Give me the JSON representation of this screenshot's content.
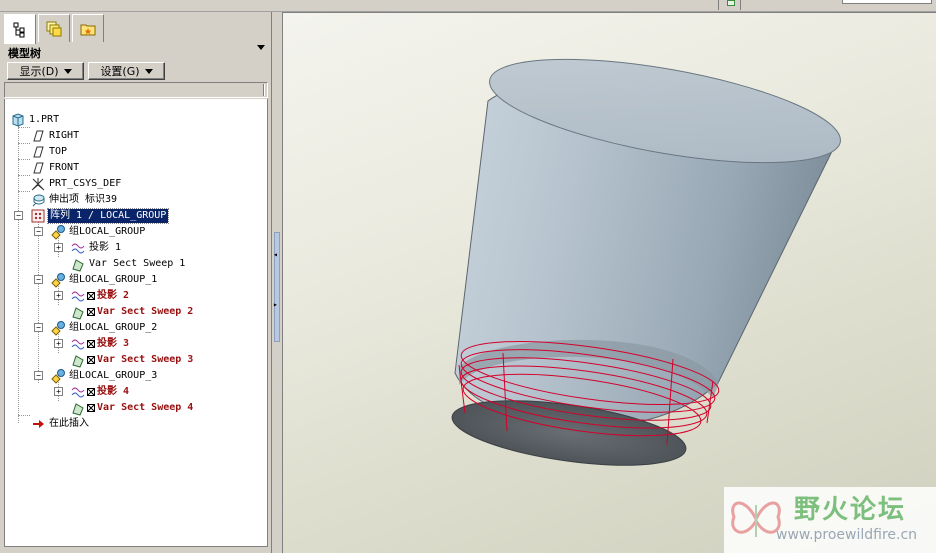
{
  "panel": {
    "title": "模型树",
    "show_button": "显示(D)",
    "settings_button": "设置(G)",
    "tabs": [
      {
        "name": "model-tree-tab",
        "icon": "tree-icon"
      },
      {
        "name": "layers-tab",
        "icon": "layers-icon"
      },
      {
        "name": "favorites-tab",
        "icon": "folder-star-icon"
      }
    ]
  },
  "tree": {
    "root": "1.PRT",
    "items": [
      {
        "label": "RIGHT",
        "icon": "datum-plane-icon"
      },
      {
        "label": "TOP",
        "icon": "datum-plane-icon"
      },
      {
        "label": "FRONT",
        "icon": "datum-plane-icon"
      },
      {
        "label": "PRT_CSYS_DEF",
        "icon": "csys-icon"
      },
      {
        "label": "伸出项 标识39",
        "icon": "protrusion-icon"
      },
      {
        "label": "阵列 1 / LOCAL_GROUP",
        "icon": "pattern-icon",
        "selected": true
      },
      {
        "label": "组LOCAL_GROUP",
        "icon": "group-icon"
      },
      {
        "label": "投影 1",
        "icon": "projected-curve-icon"
      },
      {
        "label": "Var Sect Sweep 1",
        "icon": "sweep-icon"
      },
      {
        "label": "组LOCAL_GROUP_1",
        "icon": "group-icon"
      },
      {
        "label": "投影 2",
        "icon": "projected-curve-icon",
        "status": "suppressed"
      },
      {
        "label": "Var Sect Sweep 2",
        "icon": "sweep-icon",
        "status": "suppressed"
      },
      {
        "label": "组LOCAL_GROUP_2",
        "icon": "group-icon"
      },
      {
        "label": "投影 3",
        "icon": "projected-curve-icon",
        "status": "suppressed"
      },
      {
        "label": "Var Sect Sweep 3",
        "icon": "sweep-icon",
        "status": "suppressed"
      },
      {
        "label": "组LOCAL_GROUP_3",
        "icon": "group-icon"
      },
      {
        "label": "投影 4",
        "icon": "projected-curve-icon",
        "status": "suppressed"
      },
      {
        "label": "Var Sect Sweep 4",
        "icon": "sweep-icon",
        "status": "suppressed"
      },
      {
        "label": "在此插入",
        "icon": "insert-here-arrow-icon"
      }
    ]
  },
  "viewport": {
    "model": "truncated-cone-with-thread-sweep",
    "colors": {
      "body": "#b9c7d2",
      "bottom": "#5b6166",
      "curves": "#d4002a"
    }
  },
  "watermark": {
    "cn": "野火论坛",
    "url": "www.proewildfire.cn"
  },
  "colors": {
    "selection": "#0a246a",
    "suppressed_text": "#9a1010"
  }
}
